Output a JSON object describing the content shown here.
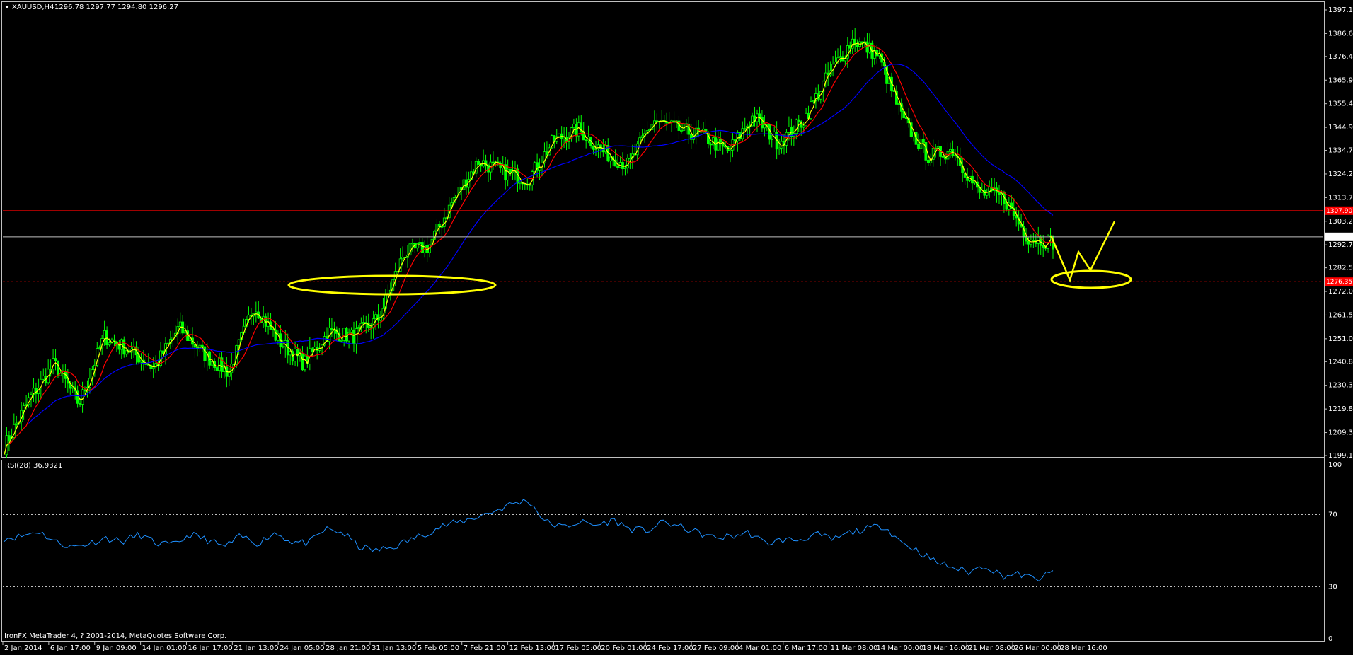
{
  "main": {
    "header": {
      "symbol_timeframe": "XAUUSD,H4",
      "quote": "1296.78 1297.77 1294.80 1296.27"
    },
    "price_axis": [
      "1397.10",
      "1386.60",
      "1376.40",
      "1365.90",
      "1355.40",
      "1344.90",
      "1334.70",
      "1324.20",
      "1313.70",
      "1303.20",
      "1292.70",
      "1282.50",
      "1272.00",
      "1261.50",
      "1251.00",
      "1240.80",
      "1230.30",
      "1219.80",
      "1209.30",
      "1199.10"
    ],
    "current_price_label": "1296.27",
    "resistance_label": "1307.90",
    "support_label": "1276.35",
    "colors": {
      "bull_candle": "#00ff00",
      "bear_candle": "#00ff00",
      "ma_fast": "#ffff00",
      "ma_mid": "#ff0000",
      "ma_slow": "#0000ff",
      "resistance": "#ff0000",
      "support": "#ff0000",
      "current": "#c0c0c0",
      "annotation": "#ffff00",
      "rsi": "#1e90ff"
    }
  },
  "rsi_panel": {
    "header": "RSI(28) 36.9321",
    "axis": [
      "100",
      "70",
      "30",
      "0"
    ]
  },
  "footer": {
    "copyright": "IronFX MetaTrader 4, ? 2001-2014, MetaQuotes Software Corp."
  },
  "time_axis": [
    "2 Jan 2014",
    "6 Jan 17:00",
    "9 Jan 09:00",
    "14 Jan 01:00",
    "16 Jan 17:00",
    "21 Jan 13:00",
    "24 Jan 05:00",
    "28 Jan 21:00",
    "31 Jan 13:00",
    "5 Feb 05:00",
    "7 Feb 21:00",
    "12 Feb 13:00",
    "17 Feb 05:00",
    "20 Feb 01:00",
    "24 Feb 17:00",
    "27 Feb 09:00",
    "4 Mar 01:00",
    "6 Mar 17:00",
    "11 Mar 08:00",
    "14 Mar 00:00",
    "18 Mar 16:00",
    "21 Mar 08:00",
    "26 Mar 00:00",
    "28 Mar 16:00"
  ],
  "chart_data": {
    "type": "line",
    "symbol": "XAUUSD",
    "timeframe": "H4",
    "x": [
      "2 Jan 2014",
      "6 Jan 17:00",
      "9 Jan 09:00",
      "14 Jan 01:00",
      "16 Jan 17:00",
      "21 Jan 13:00",
      "24 Jan 05:00",
      "28 Jan 21:00",
      "31 Jan 13:00",
      "5 Feb 05:00",
      "7 Feb 21:00",
      "12 Feb 13:00",
      "17 Feb 05:00",
      "20 Feb 01:00",
      "24 Feb 17:00",
      "27 Feb 09:00",
      "4 Mar 01:00",
      "6 Mar 17:00",
      "11 Mar 08:00",
      "14 Mar 00:00",
      "18 Mar 16:00",
      "21 Mar 08:00",
      "26 Mar 00:00",
      "28 Mar 16:00"
    ],
    "price_path": [
      1203,
      1224,
      1240,
      1222,
      1252,
      1246,
      1238,
      1256,
      1244,
      1236,
      1266,
      1250,
      1240,
      1254,
      1252,
      1260,
      1289,
      1292,
      1313,
      1330,
      1325,
      1322,
      1339,
      1344,
      1334,
      1328,
      1348,
      1344,
      1341,
      1334,
      1350,
      1338,
      1348,
      1368,
      1384,
      1377,
      1348,
      1332,
      1335,
      1316,
      1314,
      1296,
      1294
    ],
    "ylim": [
      1199.1,
      1397.1
    ],
    "horizontal_levels": {
      "resistance": 1307.9,
      "support": 1276.35,
      "current": 1296.27
    },
    "rsi": {
      "period": 28,
      "last": 36.9321,
      "ylim": [
        0,
        100
      ],
      "levels": [
        70,
        30
      ],
      "values": [
        57,
        58,
        61,
        55,
        52,
        54,
        57,
        55,
        59,
        54,
        53,
        59,
        56,
        52,
        58,
        54,
        60,
        55,
        54,
        62,
        60,
        52,
        50,
        52,
        56,
        60,
        64,
        66,
        69,
        72,
        76,
        78,
        66,
        63,
        66,
        64,
        67,
        62,
        61,
        66,
        63,
        60,
        57,
        58,
        60,
        54,
        56,
        56,
        59,
        56,
        60,
        62,
        64,
        55,
        50,
        44,
        41,
        38,
        42,
        36,
        37,
        34,
        38
      ]
    }
  }
}
